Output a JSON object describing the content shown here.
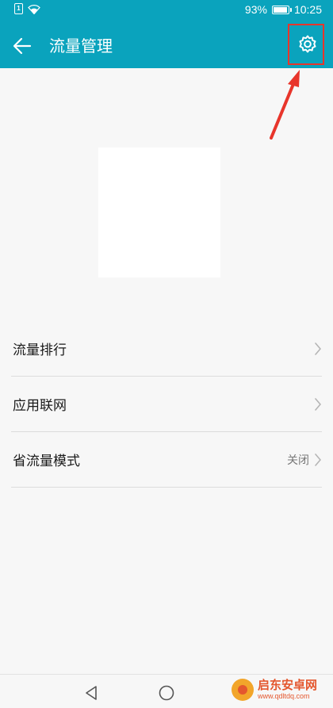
{
  "status_bar": {
    "sim_label": "1",
    "battery_percent": 93,
    "battery_text": "93%",
    "time": "10:25"
  },
  "header": {
    "title": "流量管理",
    "back_icon": "arrow-left-icon",
    "settings_icon": "gear-icon",
    "background_color": "#0aa3bd"
  },
  "annotation": {
    "highlight_color": "#e8352b"
  },
  "list": {
    "items": [
      {
        "label": "流量排行",
        "value": ""
      },
      {
        "label": "应用联网",
        "value": ""
      },
      {
        "label": "省流量模式",
        "value": "关闭"
      }
    ]
  },
  "nav_bar": {
    "back_icon": "triangle-back-icon",
    "home_icon": "circle-home-icon"
  },
  "watermark": {
    "name": "启东安卓网",
    "url": "www.qdltdq.com"
  }
}
